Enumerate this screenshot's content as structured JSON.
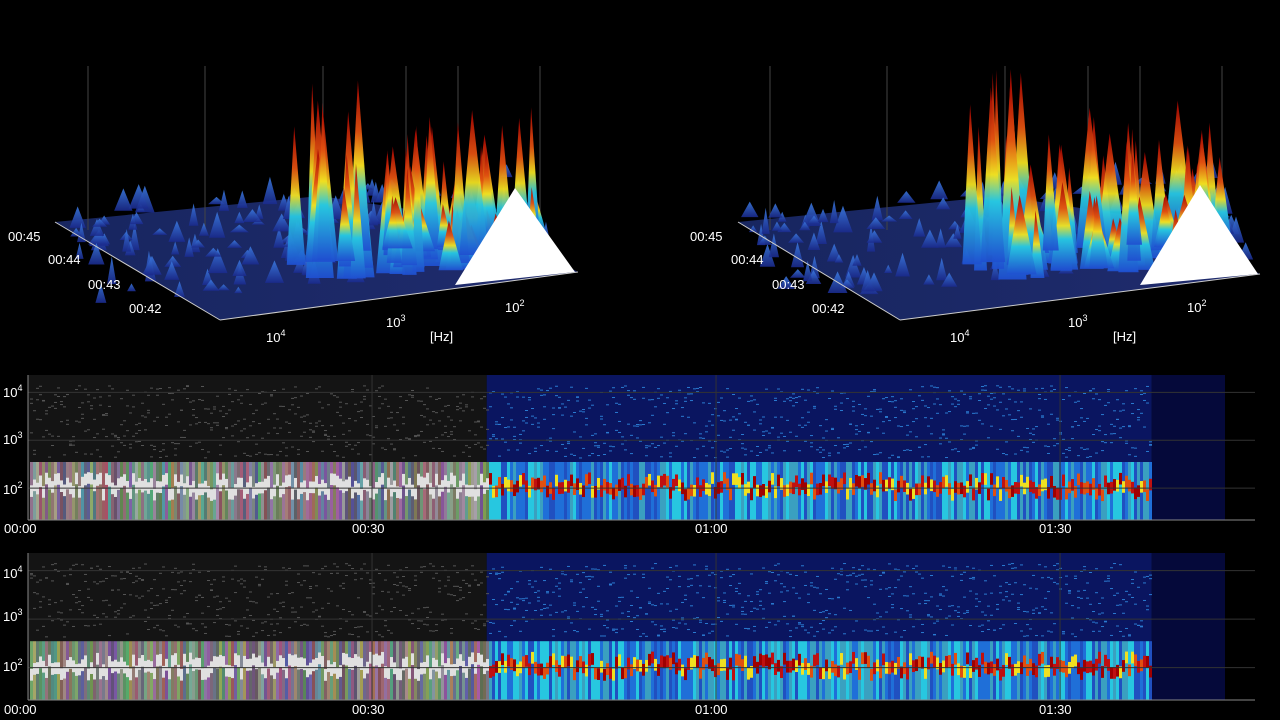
{
  "chart_data": [
    {
      "type": "surface3d",
      "panel": "left",
      "time_ticks": [
        "00:45",
        "00:44",
        "00:43",
        "00:42"
      ],
      "freq_ticks": [
        {
          "base": "10",
          "exp": "4"
        },
        {
          "base": "10",
          "exp": "3"
        },
        {
          "base": "10",
          "exp": "2"
        }
      ],
      "freq_unit": "[Hz]",
      "colormap": [
        "#1a2a8c",
        "#1f6fd8",
        "#27c7e0",
        "#f0e020",
        "#e05010",
        "#a00000",
        "#ffffff"
      ]
    },
    {
      "type": "surface3d",
      "panel": "right",
      "time_ticks": [
        "00:45",
        "00:44",
        "00:43",
        "00:42"
      ],
      "freq_ticks": [
        {
          "base": "10",
          "exp": "4"
        },
        {
          "base": "10",
          "exp": "3"
        },
        {
          "base": "10",
          "exp": "2"
        }
      ],
      "freq_unit": "[Hz]",
      "colormap": [
        "#1a2a8c",
        "#1f6fd8",
        "#27c7e0",
        "#f0e020",
        "#e05010",
        "#a00000",
        "#ffffff"
      ]
    },
    {
      "type": "heatmap",
      "panel": "top-spectrogram",
      "x_ticks": [
        "00:00",
        "00:30",
        "01:00",
        "01:30"
      ],
      "x_tick_seconds": [
        0,
        30,
        60,
        90
      ],
      "xlim_seconds": [
        0,
        107
      ],
      "y_ticks": [
        {
          "base": "10",
          "exp": "4",
          "hz": 10000
        },
        {
          "base": "10",
          "exp": "3",
          "hz": 1000
        },
        {
          "base": "10",
          "exp": "2",
          "hz": 100
        }
      ],
      "grayscale_until_seconds": 40,
      "signal_end_seconds": 98
    },
    {
      "type": "heatmap",
      "panel": "bottom-spectrogram",
      "x_ticks": [
        "00:00",
        "00:30",
        "01:00",
        "01:30"
      ],
      "x_tick_seconds": [
        0,
        30,
        60,
        90
      ],
      "xlim_seconds": [
        0,
        107
      ],
      "y_ticks": [
        {
          "base": "10",
          "exp": "4",
          "hz": 10000
        },
        {
          "base": "10",
          "exp": "3",
          "hz": 1000
        },
        {
          "base": "10",
          "exp": "2",
          "hz": 100
        }
      ],
      "grayscale_until_seconds": 40,
      "signal_end_seconds": 98
    }
  ]
}
